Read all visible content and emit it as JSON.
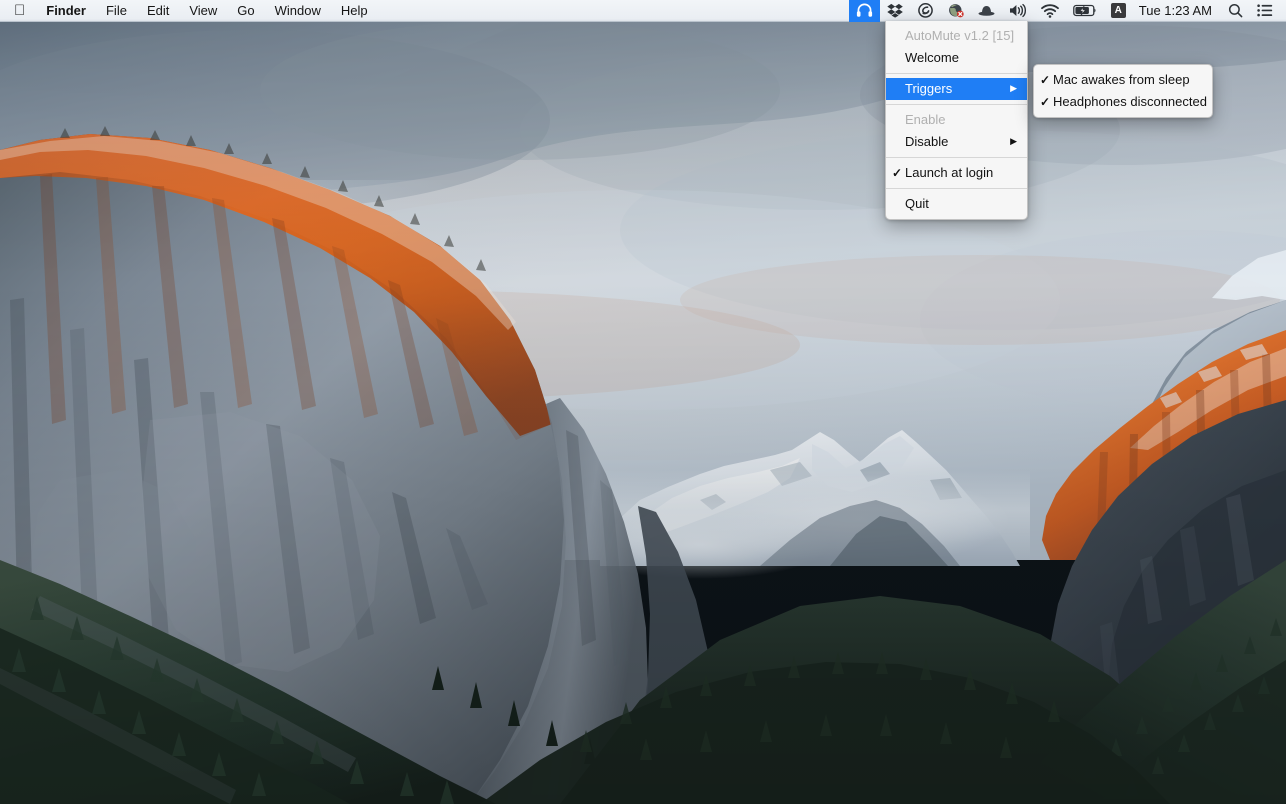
{
  "menubar": {
    "apple_logo": "",
    "app_menus": [
      {
        "label": "Finder",
        "bold": true
      },
      {
        "label": "File",
        "bold": false
      },
      {
        "label": "Edit",
        "bold": false
      },
      {
        "label": "View",
        "bold": false
      },
      {
        "label": "Go",
        "bold": false
      },
      {
        "label": "Window",
        "bold": false
      },
      {
        "label": "Help",
        "bold": false
      }
    ],
    "status_items": [
      {
        "icon": "headphones-icon",
        "active": true
      },
      {
        "icon": "dropbox-icon",
        "active": false
      },
      {
        "icon": "creative-cloud-icon",
        "active": false
      },
      {
        "icon": "globe-error-icon",
        "active": false
      },
      {
        "icon": "bowler-hat-icon",
        "active": false
      },
      {
        "icon": "volume-icon",
        "active": false
      },
      {
        "icon": "wifi-icon",
        "active": false
      },
      {
        "icon": "battery-charging-icon",
        "active": false
      },
      {
        "icon": "input-source-icon",
        "label": "A",
        "active": false
      }
    ],
    "clock": "Tue 1:23 AM",
    "search_icon": "search-icon",
    "notification_center_icon": "notification-center-icon"
  },
  "automute_menu": {
    "items": [
      {
        "label": "AutoMute v1.2 [15]",
        "disabled": true,
        "checked": false,
        "submenu": false,
        "selected": false
      },
      {
        "label": "Welcome",
        "disabled": false,
        "checked": false,
        "submenu": false,
        "selected": false
      },
      {
        "separator": true
      },
      {
        "label": "Triggers",
        "disabled": false,
        "checked": false,
        "submenu": true,
        "selected": true
      },
      {
        "separator": true
      },
      {
        "label": "Enable",
        "disabled": true,
        "checked": false,
        "submenu": false,
        "selected": false
      },
      {
        "label": "Disable",
        "disabled": false,
        "checked": false,
        "submenu": true,
        "selected": false
      },
      {
        "separator": true
      },
      {
        "label": "Launch at login",
        "disabled": false,
        "checked": true,
        "submenu": false,
        "selected": false
      },
      {
        "separator": true
      },
      {
        "label": "Quit",
        "disabled": false,
        "checked": false,
        "submenu": false,
        "selected": false
      }
    ],
    "arrow_glyph": "▶",
    "check_glyph": "✓"
  },
  "triggers_submenu": {
    "items": [
      {
        "label": "Mac awakes from sleep",
        "checked": true
      },
      {
        "label": "Headphones disconnected",
        "checked": true
      }
    ],
    "check_glyph": "✓"
  },
  "colors": {
    "menubar_bg": "#eef1f5",
    "menu_bg": "#f6f6f6",
    "highlight_blue": "#1f7ef5",
    "disabled_text": "#b0b0b0",
    "text": "#121212"
  },
  "wallpaper": {
    "name": "OS X El Capitan - Yosemite Valley at sunset"
  }
}
